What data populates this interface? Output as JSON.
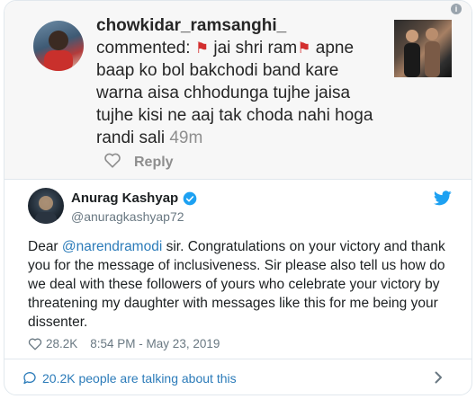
{
  "comment": {
    "username": "chowkidar_ramsanghi_",
    "prefix": "commented:",
    "text_a": "jai shri ram",
    "text_b": "apne baap ko bol bakchodi band kare warna aisa chhodunga tujhe jaisa tujhe kisi ne aaj tak choda nahi hoga randi sali",
    "time": "49m",
    "reply_label": "Reply"
  },
  "tweet": {
    "author_name": "Anurag Kashyap",
    "handle": "@anuragkashyap72",
    "text_before": "Dear ",
    "mention": "@narendramodi",
    "text_after": " sir. Congratulations on your victory and thank you for the message of inclusiveness. Sir please also tell us how do we deal with these followers of yours who celebrate your victory by threatening my daughter with messages like this for me being your dissenter.",
    "likes": "28.2K",
    "timestamp": "8:54 PM - May 23, 2019"
  },
  "footer": {
    "talking": "20.2K people are talking about this"
  },
  "colors": {
    "link": "#2b7bb9",
    "twitter_blue": "#1da1f2",
    "flag_red": "#d32f2f"
  }
}
